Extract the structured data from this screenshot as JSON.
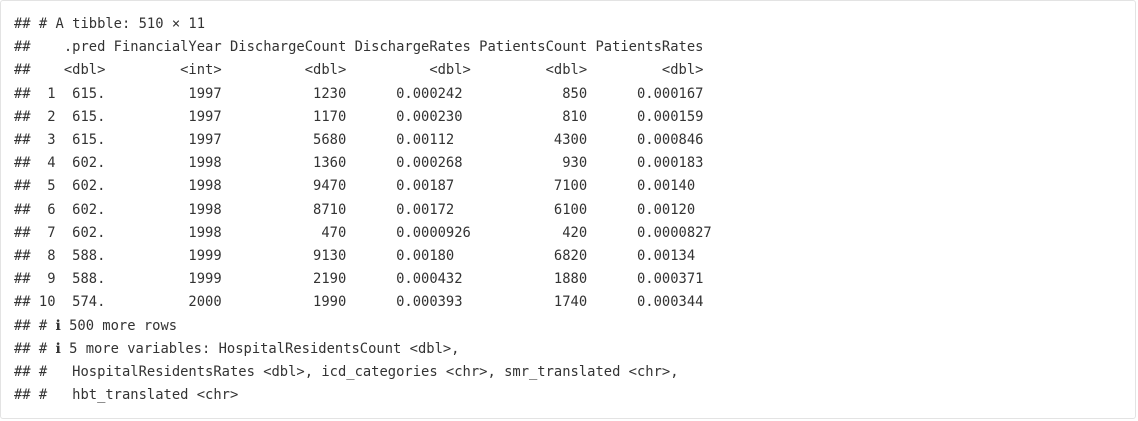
{
  "output": {
    "lines": [
      "## # A tibble: 510 × 11",
      "##    .pred FinancialYear DischargeCount DischargeRates PatientsCount PatientsRates",
      "##    <dbl>         <int>          <dbl>          <dbl>         <dbl>         <dbl>",
      "##  1  615.          1997           1230      0.000242            850      0.000167",
      "##  2  615.          1997           1170      0.000230            810      0.000159",
      "##  3  615.          1997           5680      0.00112            4300      0.000846",
      "##  4  602.          1998           1360      0.000268            930      0.000183",
      "##  5  602.          1998           9470      0.00187            7100      0.00140",
      "##  6  602.          1998           8710      0.00172            6100      0.00120",
      "##  7  602.          1998            470      0.0000926           420      0.0000827",
      "##  8  588.          1999           9130      0.00180            6820      0.00134",
      "##  9  588.          1999           2190      0.000432           1880      0.000371",
      "## 10  574.          2000           1990      0.000393           1740      0.000344",
      "## # ℹ 500 more rows",
      "## # ℹ 5 more variables: HospitalResidentsCount <dbl>,",
      "## #   HospitalResidentsRates <dbl>, icd_categories <chr>, smr_translated <chr>,",
      "## #   hbt_translated <chr>"
    ]
  }
}
